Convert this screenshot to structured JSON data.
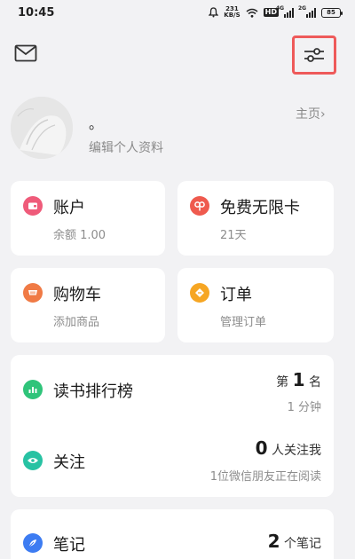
{
  "status_bar": {
    "time": "10:45",
    "net_speed_value": "231",
    "net_speed_unit": "KB/S",
    "hd_label": "HD",
    "sim1_label": "4G",
    "sim2_label": "2G",
    "battery": "85"
  },
  "profile": {
    "nickname": "。",
    "edit_label": "编辑个人资料",
    "homepage_label": "主页",
    "homepage_arrow": "›"
  },
  "grid": [
    {
      "title": "账户",
      "subtitle": "余额 1.00",
      "icon": "wallet-icon",
      "color": "#ef5b7a"
    },
    {
      "title": "免费无限卡",
      "subtitle": "21天",
      "icon": "infinity-card-icon",
      "color": "#ef5a4e"
    },
    {
      "title": "购物车",
      "subtitle": "添加商品",
      "icon": "cart-icon",
      "color": "#f07a45"
    },
    {
      "title": "订单",
      "subtitle": "管理订单",
      "icon": "order-icon",
      "color": "#f6a623"
    }
  ],
  "ranking": {
    "title": "读书排行榜",
    "icon": "ranking-chart-icon",
    "color": "#2fc47a",
    "rank_prefix": "第",
    "rank_value": "1",
    "rank_suffix": "名",
    "duration": "1 分钟"
  },
  "follow": {
    "title": "关注",
    "icon": "eye-icon",
    "color": "#27c2a3",
    "count": "0",
    "count_suffix": "人关注我",
    "friends_reading": "1位微信朋友正在阅读"
  },
  "notes": {
    "title": "笔记",
    "icon": "feather-icon",
    "color": "#3d7cf2",
    "count": "2",
    "count_suffix": "个笔记"
  }
}
